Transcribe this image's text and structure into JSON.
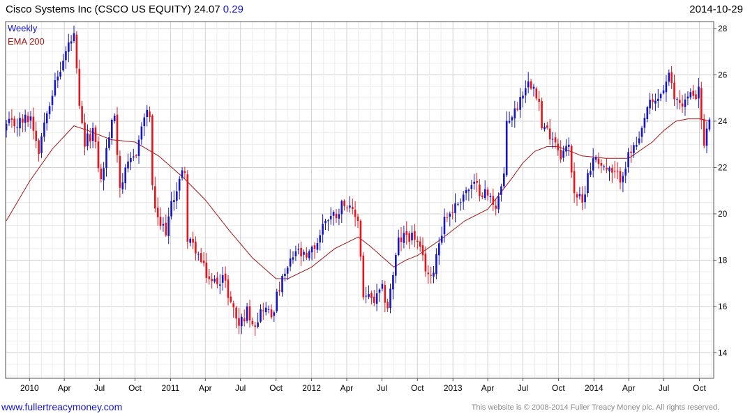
{
  "header": {
    "title": "Cisco Systems Inc (CSCO US EQUITY) 24.07",
    "change": "0.29",
    "date": "2014-10-29"
  },
  "legend": {
    "weekly": "Weekly",
    "ema": "EMA 200"
  },
  "footer": {
    "url": "www.fullertreacymoney.com",
    "copyright": "This website is © 2008-2014 Fuller Treacy Money plc. All rights reserved."
  },
  "colors": {
    "up": "#1515c8",
    "down": "#e8141c",
    "ema": "#a01818",
    "grid": "#d8d8d8"
  },
  "chart_data": {
    "type": "candlestick",
    "period": "weekly",
    "x_range": [
      "2009-10-31",
      "2014-11-07"
    ],
    "ylim": [
      12.9,
      28.3
    ],
    "y_axis_side": "right",
    "y_ticks": [
      14,
      16,
      18,
      20,
      22,
      24,
      26,
      28
    ],
    "x_ticks": [
      {
        "date": "2010-01-01",
        "label": "2010"
      },
      {
        "date": "2010-04-01",
        "label": "Apr"
      },
      {
        "date": "2010-07-01",
        "label": "Jul"
      },
      {
        "date": "2010-10-01",
        "label": "Oct"
      },
      {
        "date": "2011-01-01",
        "label": "2011"
      },
      {
        "date": "2011-04-01",
        "label": "Apr"
      },
      {
        "date": "2011-07-01",
        "label": "Jul"
      },
      {
        "date": "2011-10-01",
        "label": "Oct"
      },
      {
        "date": "2012-01-01",
        "label": "2012"
      },
      {
        "date": "2012-04-01",
        "label": "Apr"
      },
      {
        "date": "2012-07-01",
        "label": "Jul"
      },
      {
        "date": "2012-10-01",
        "label": "Oct"
      },
      {
        "date": "2013-01-01",
        "label": "2013"
      },
      {
        "date": "2013-04-01",
        "label": "Apr"
      },
      {
        "date": "2013-07-01",
        "label": "Jul"
      },
      {
        "date": "2013-10-01",
        "label": "Oct"
      },
      {
        "date": "2014-01-01",
        "label": "2014"
      },
      {
        "date": "2014-04-01",
        "label": "Apr"
      },
      {
        "date": "2014-07-01",
        "label": "Jul"
      },
      {
        "date": "2014-10-01",
        "label": "Oct"
      }
    ],
    "grid": true,
    "legend_position": "top-left",
    "price_path": [
      [
        "2009-11-02",
        23.8
      ],
      [
        "2009-12-01",
        23.9
      ],
      [
        "2010-01-04",
        24.2
      ],
      [
        "2010-01-25",
        22.8
      ],
      [
        "2010-02-15",
        24.6
      ],
      [
        "2010-03-15",
        25.9
      ],
      [
        "2010-04-12",
        27.3
      ],
      [
        "2010-04-26",
        27.6
      ],
      [
        "2010-05-10",
        24.5
      ],
      [
        "2010-05-24",
        23.0
      ],
      [
        "2010-06-14",
        23.6
      ],
      [
        "2010-07-05",
        21.4
      ],
      [
        "2010-07-26",
        23.4
      ],
      [
        "2010-08-09",
        24.3
      ],
      [
        "2010-08-23",
        21.2
      ],
      [
        "2010-09-13",
        22.0
      ],
      [
        "2010-10-04",
        22.7
      ],
      [
        "2010-10-25",
        24.2
      ],
      [
        "2010-11-08",
        24.3
      ],
      [
        "2010-11-15",
        21.0
      ],
      [
        "2010-11-29",
        19.6
      ],
      [
        "2010-12-20",
        19.3
      ],
      [
        "2011-01-10",
        20.8
      ],
      [
        "2011-02-07",
        22.0
      ],
      [
        "2011-02-14",
        18.8
      ],
      [
        "2011-03-07",
        18.5
      ],
      [
        "2011-03-28",
        17.6
      ],
      [
        "2011-04-18",
        17.0
      ],
      [
        "2011-05-16",
        17.3
      ],
      [
        "2011-06-06",
        16.2
      ],
      [
        "2011-06-27",
        15.2
      ],
      [
        "2011-07-18",
        15.8
      ],
      [
        "2011-08-08",
        15.3
      ],
      [
        "2011-08-29",
        16.0
      ],
      [
        "2011-09-19",
        15.6
      ],
      [
        "2011-10-10",
        16.8
      ],
      [
        "2011-10-31",
        17.6
      ],
      [
        "2011-11-21",
        18.4
      ],
      [
        "2011-12-19",
        18.0
      ],
      [
        "2012-01-16",
        18.8
      ],
      [
        "2012-02-06",
        19.8
      ],
      [
        "2012-03-05",
        20.0
      ],
      [
        "2012-03-26",
        20.6
      ],
      [
        "2012-04-09",
        20.1
      ],
      [
        "2012-04-30",
        19.8
      ],
      [
        "2012-05-14",
        16.5
      ],
      [
        "2012-06-11",
        16.2
      ],
      [
        "2012-07-02",
        16.7
      ],
      [
        "2012-07-16",
        16.0
      ],
      [
        "2012-08-13",
        18.8
      ],
      [
        "2012-09-03",
        19.1
      ],
      [
        "2012-09-24",
        19.0
      ],
      [
        "2012-10-15",
        18.0
      ],
      [
        "2012-11-05",
        17.1
      ],
      [
        "2012-11-19",
        18.3
      ],
      [
        "2012-12-10",
        19.8
      ],
      [
        "2013-01-07",
        20.3
      ],
      [
        "2013-01-28",
        20.9
      ],
      [
        "2013-02-25",
        21.2
      ],
      [
        "2013-03-25",
        20.9
      ],
      [
        "2013-04-22",
        20.4
      ],
      [
        "2013-05-13",
        21.5
      ],
      [
        "2013-05-20",
        24.0
      ],
      [
        "2013-06-10",
        24.4
      ],
      [
        "2013-07-08",
        25.6
      ],
      [
        "2013-07-29",
        25.7
      ],
      [
        "2013-08-12",
        24.8
      ],
      [
        "2013-08-19",
        23.7
      ],
      [
        "2013-09-16",
        23.4
      ],
      [
        "2013-10-07",
        22.6
      ],
      [
        "2013-10-28",
        22.9
      ],
      [
        "2013-11-11",
        21.0
      ],
      [
        "2013-12-02",
        20.4
      ],
      [
        "2013-12-16",
        21.8
      ],
      [
        "2014-01-06",
        22.5
      ],
      [
        "2014-01-27",
        22.0
      ],
      [
        "2014-02-17",
        21.7
      ],
      [
        "2014-03-10",
        21.6
      ],
      [
        "2014-04-07",
        22.7
      ],
      [
        "2014-04-28",
        23.0
      ],
      [
        "2014-05-19",
        24.6
      ],
      [
        "2014-06-09",
        24.8
      ],
      [
        "2014-06-30",
        25.4
      ],
      [
        "2014-07-14",
        25.9
      ],
      [
        "2014-07-28",
        25.0
      ],
      [
        "2014-08-18",
        24.8
      ],
      [
        "2014-09-08",
        25.1
      ],
      [
        "2014-09-29",
        25.3
      ],
      [
        "2014-10-13",
        22.9
      ],
      [
        "2014-10-27",
        24.07
      ]
    ],
    "series": [
      {
        "name": "EMA 200",
        "type": "line",
        "points": [
          [
            "2009-11-02",
            19.7
          ],
          [
            "2010-01-01",
            21.4
          ],
          [
            "2010-03-01",
            22.8
          ],
          [
            "2010-04-26",
            23.8
          ],
          [
            "2010-06-01",
            23.6
          ],
          [
            "2010-08-01",
            23.2
          ],
          [
            "2010-10-01",
            23.1
          ],
          [
            "2010-12-01",
            22.5
          ],
          [
            "2011-02-01",
            21.6
          ],
          [
            "2011-04-01",
            20.6
          ],
          [
            "2011-06-01",
            19.3
          ],
          [
            "2011-08-01",
            18.1
          ],
          [
            "2011-10-01",
            17.2
          ],
          [
            "2011-11-01",
            17.2
          ],
          [
            "2012-01-01",
            17.7
          ],
          [
            "2012-03-01",
            18.5
          ],
          [
            "2012-05-01",
            19.0
          ],
          [
            "2012-06-01",
            18.6
          ],
          [
            "2012-08-01",
            17.7
          ],
          [
            "2012-09-01",
            18.0
          ],
          [
            "2012-10-01",
            18.2
          ],
          [
            "2012-12-01",
            18.9
          ],
          [
            "2013-02-01",
            19.7
          ],
          [
            "2013-04-01",
            20.2
          ],
          [
            "2013-06-01",
            21.5
          ],
          [
            "2013-07-01",
            22.2
          ],
          [
            "2013-08-01",
            22.7
          ],
          [
            "2013-09-01",
            22.9
          ],
          [
            "2013-10-01",
            22.9
          ],
          [
            "2013-12-01",
            22.5
          ],
          [
            "2014-02-01",
            22.4
          ],
          [
            "2014-04-01",
            22.4
          ],
          [
            "2014-06-01",
            23.1
          ],
          [
            "2014-07-01",
            23.6
          ],
          [
            "2014-08-01",
            24.0
          ],
          [
            "2014-09-01",
            24.1
          ],
          [
            "2014-10-01",
            24.1
          ],
          [
            "2014-10-27",
            24.0
          ]
        ]
      }
    ]
  }
}
